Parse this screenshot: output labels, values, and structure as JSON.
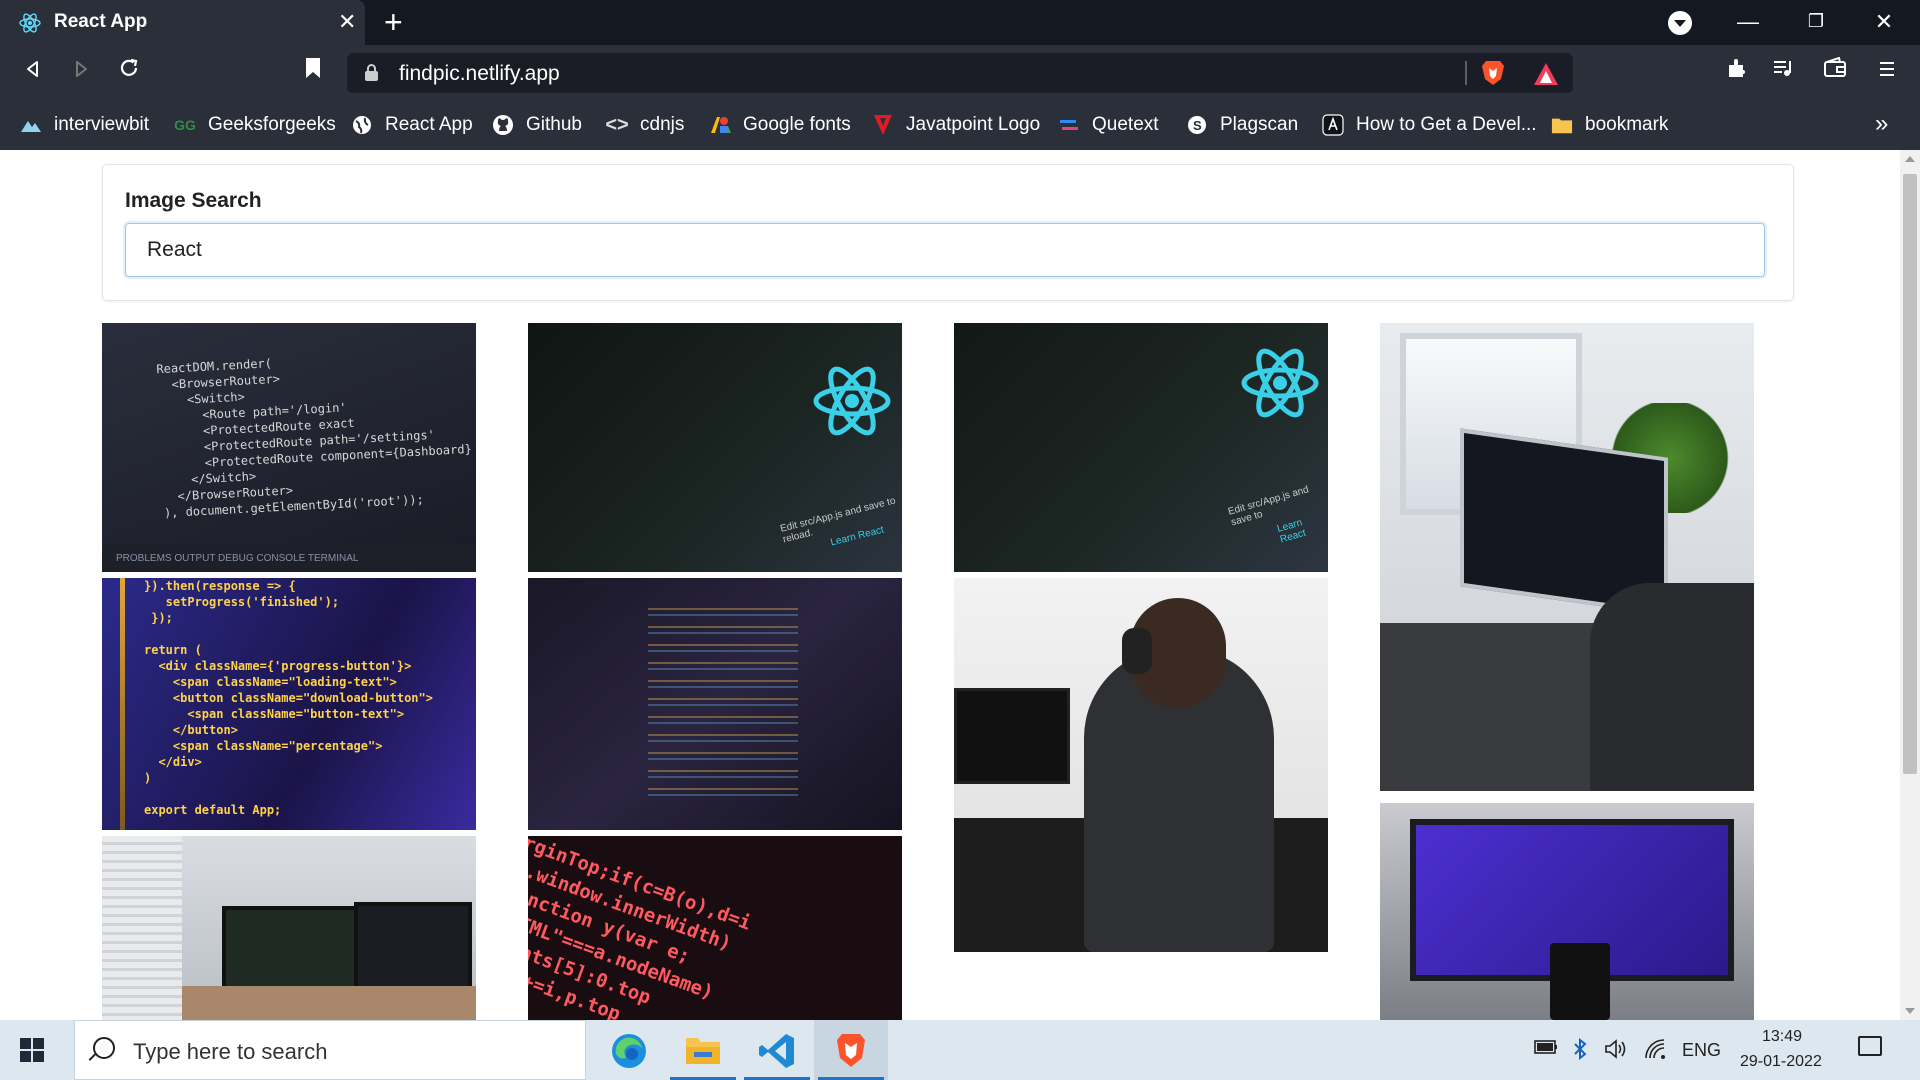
{
  "browser": {
    "tab_title": "React App",
    "tab_close": "✕",
    "new_tab": "+",
    "url": "findpic.netlify.app",
    "window_controls": {
      "minimize": "—",
      "restore": "❐",
      "close": "✕"
    },
    "bookmarks": [
      {
        "label": "interviewbit",
        "icon": "interviewbit-icon",
        "color": "#4fa3d1"
      },
      {
        "label": "Geeksforgeeks",
        "icon": "geeksforgeeks-icon",
        "color": "#2f8d46"
      },
      {
        "label": "React App",
        "icon": "globe-icon",
        "color": "#ffffff"
      },
      {
        "label": "Github",
        "icon": "github-icon",
        "color": "#ffffff"
      },
      {
        "label": "cdnjs",
        "icon": "code-icon",
        "color": "#ffffff"
      },
      {
        "label": "Google fonts",
        "icon": "google-fonts-icon",
        "color": "#4285f4"
      },
      {
        "label": "Javatpoint Logo",
        "icon": "javatpoint-icon",
        "color": "#e31b23"
      },
      {
        "label": "Quetext",
        "icon": "quetext-icon",
        "color": "#6a5acd"
      },
      {
        "label": "Plagscan",
        "icon": "plagscan-icon",
        "color": "#ffffff"
      },
      {
        "label": "How to Get a Devel...",
        "icon": "angular-icon",
        "color": "#ffffff"
      },
      {
        "label": "bookmark",
        "icon": "folder-icon",
        "color": "#f5c451"
      }
    ],
    "bookmarks_more": "»"
  },
  "page": {
    "search_label": "Image Search",
    "search_value": "React",
    "images": [
      {
        "subject": "react-router-code-screenshot",
        "snippet": "ReactDOM.render(\n  <BrowserRouter>\n    <Switch>\n      <Route path='/login'\n      <ProtectedRoute exact\n      <ProtectedRoute path='/settings'\n      <ProtectedRoute component={Dashboard}\n    </Switch>\n  </BrowserRouter>\n), document.getElementById('root'));",
        "tab_labels": "PROBLEMS    OUTPUT    DEBUG CONSOLE    TERMINAL"
      },
      {
        "subject": "react-logo-code-monitor",
        "caption": "Edit src/App.js and save to reload.",
        "link": "Learn React"
      },
      {
        "subject": "react-logo-code-monitor-2",
        "caption": "Edit src/App.js and save to",
        "link": "Learn React"
      },
      {
        "subject": "laptop-coding-by-window"
      },
      {
        "subject": "jsx-progress-code",
        "snippet": "}).then(response => {\n   setProgress('finished');\n });\n\nreturn (\n  <div className={'progress-button'}>\n    <span className=\"loading-text\">\n    <button className=\"download-button\">\n      <span className=\"button-text\">\n    </button>\n    <span className=\"percentage\">\n  </div>\n)\n\nexport default App;"
      },
      {
        "subject": "code-editor-dark-monitor"
      },
      {
        "subject": "developer-with-headphones"
      },
      {
        "subject": "desk-setup-with-monitors"
      },
      {
        "subject": "red-code-closeup",
        "snippet": "arginTop;if(c=B(o),d=i\nth.window.innerWidth)\n;function y(var e;\n(\"HTML\"===a.nodeName)\nguments[5]:0.top\n.left+=i,p.top"
      },
      {
        "subject": "purple-code-monitor-with-mug"
      }
    ]
  },
  "taskbar": {
    "search_placeholder": "Type here to search",
    "language": "ENG",
    "time": "13:49",
    "date": "29-01-2022"
  }
}
